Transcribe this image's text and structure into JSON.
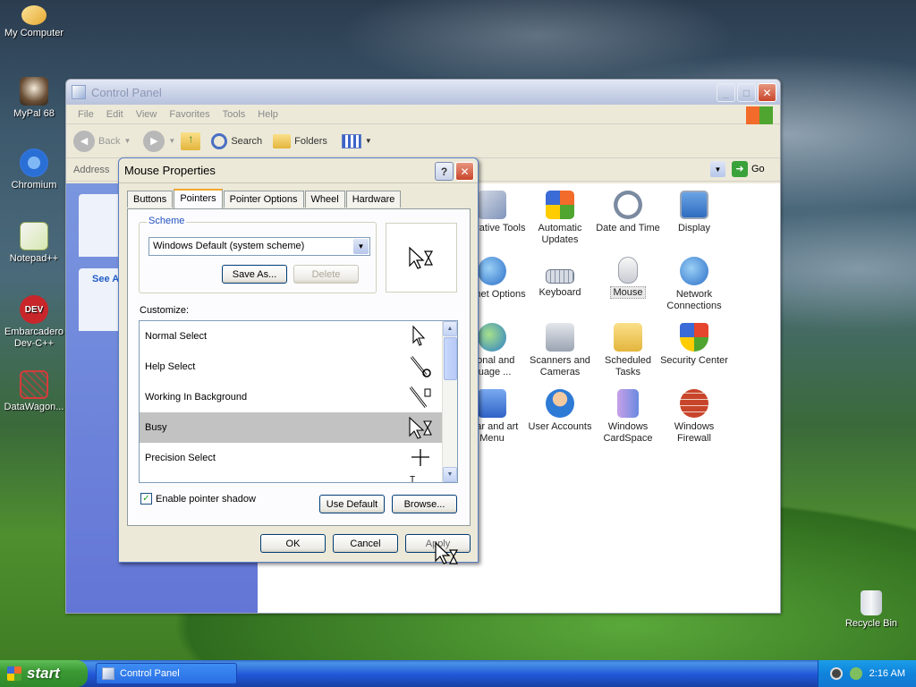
{
  "desktop": {
    "icons": [
      {
        "label": "My Computer"
      },
      {
        "label": "MyPal 68"
      },
      {
        "label": "Chromium"
      },
      {
        "label": "Notepad++"
      },
      {
        "label": "Embarcadero Dev-C++"
      },
      {
        "label": "DataWagon..."
      },
      {
        "label": "Recycle Bin"
      }
    ]
  },
  "control_panel": {
    "title": "Control Panel",
    "menu": [
      "File",
      "Edit",
      "View",
      "Favorites",
      "Tools",
      "Help"
    ],
    "toolbar": {
      "back": "Back",
      "search": "Search",
      "folders": "Folders"
    },
    "address_label": "Address",
    "go_label": "Go",
    "left_pane": {
      "see_also_partial": "See A"
    },
    "items": [
      {
        "label": "Administrative Tools",
        "shown": "inistrative Tools",
        "icon": "admin-tools-icon"
      },
      {
        "label": "Automatic Updates",
        "shown": "Automatic Updates",
        "icon": "automatic-updates-icon"
      },
      {
        "label": "Date and Time",
        "shown": "Date and Time",
        "icon": "date-time-icon"
      },
      {
        "label": "Display",
        "shown": "Display",
        "icon": "display-icon"
      },
      {
        "label": "Internet Options",
        "shown": "nternet Options",
        "icon": "internet-options-icon"
      },
      {
        "label": "Keyboard",
        "shown": "Keyboard",
        "icon": "keyboard-icon"
      },
      {
        "label": "Mouse",
        "shown": "Mouse",
        "icon": "mouse-icon"
      },
      {
        "label": "Network Connections",
        "shown": "Network Connections",
        "icon": "network-icon"
      },
      {
        "label": "Regional and Language ...",
        "shown": "gional and guage ...",
        "icon": "regional-icon"
      },
      {
        "label": "Scanners and Cameras",
        "shown": "Scanners and Cameras",
        "icon": "scanners-icon"
      },
      {
        "label": "Scheduled Tasks",
        "shown": "Scheduled Tasks",
        "icon": "scheduled-tasks-icon"
      },
      {
        "label": "Security Center",
        "shown": "Security Center",
        "icon": "security-center-icon"
      },
      {
        "label": "Taskbar and Start Menu",
        "shown": "kbar and art Menu",
        "icon": "taskbar-icon"
      },
      {
        "label": "User Accounts",
        "shown": "User Accounts",
        "icon": "user-accounts-icon"
      },
      {
        "label": "Windows CardSpace",
        "shown": "Windows CardSpace",
        "icon": "cardspace-icon"
      },
      {
        "label": "Windows Firewall",
        "shown": "Windows Firewall",
        "icon": "firewall-icon"
      }
    ]
  },
  "dialog": {
    "title": "Mouse Properties",
    "tabs": [
      "Buttons",
      "Pointers",
      "Pointer Options",
      "Wheel",
      "Hardware"
    ],
    "selected_tab": "Pointers",
    "scheme": {
      "legend": "Scheme",
      "value": "Windows Default (system scheme)",
      "save_as": "Save As...",
      "delete": "Delete"
    },
    "customize_label": "Customize:",
    "pointers": [
      {
        "name": "Normal Select"
      },
      {
        "name": "Help Select"
      },
      {
        "name": "Working In Background"
      },
      {
        "name": "Busy"
      },
      {
        "name": "Precision Select"
      }
    ],
    "selected_pointer": "Busy",
    "enable_shadow_label": "Enable pointer shadow",
    "enable_shadow_checked": true,
    "use_default": "Use Default",
    "browse": "Browse...",
    "ok": "OK",
    "cancel": "Cancel",
    "apply": "Apply"
  },
  "taskbar": {
    "start": "start",
    "task": "Control Panel",
    "clock": "2:16 AM"
  },
  "colors": {
    "selection": "#c2c2c2",
    "taskbar": "#2157d7",
    "start": "#3c9a35"
  }
}
